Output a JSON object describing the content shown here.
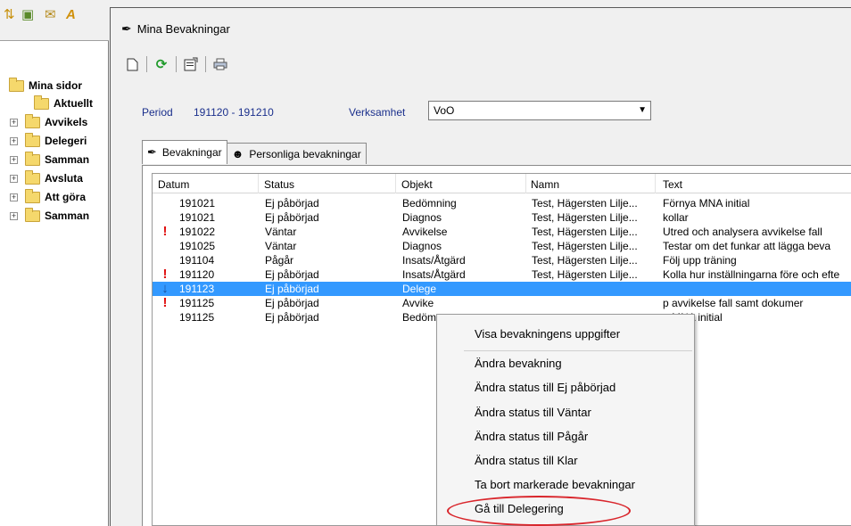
{
  "left_pane": {
    "toolbar_icons": [
      "sort-icon",
      "image-icon",
      "mail-icon",
      "font-icon"
    ],
    "tree": [
      {
        "label": "Mina sidor",
        "level": 0,
        "expandable": false
      },
      {
        "label": "Aktuellt",
        "level": 1,
        "expandable": false
      },
      {
        "label": "Avvikels",
        "level": 1,
        "expandable": true
      },
      {
        "label": "Delegeri",
        "level": 1,
        "expandable": true
      },
      {
        "label": "Samman",
        "level": 1,
        "expandable": true
      },
      {
        "label": "Avsluta",
        "level": 1,
        "expandable": true
      },
      {
        "label": "Att göra",
        "level": 1,
        "expandable": true
      },
      {
        "label": "Samman",
        "level": 1,
        "expandable": true
      }
    ]
  },
  "window": {
    "title": "Mina Bevakningar",
    "title_icon": "pen-icon"
  },
  "toolbar": {
    "icons": [
      "new-document-icon",
      "refresh-icon",
      "properties-icon",
      "print-icon"
    ]
  },
  "filter": {
    "period_label": "Period",
    "period_value": "191120 - 191210",
    "verksamhet_label": "Verksamhet",
    "verksamhet_value": "VoO"
  },
  "tabs": [
    {
      "label": "Bevakningar",
      "icon": "pen-icon",
      "active": true
    },
    {
      "label": "Personliga bevakningar",
      "icon": "person-icon",
      "active": false
    }
  ],
  "table": {
    "columns": [
      "Datum",
      "Status",
      "Objekt",
      "Namn",
      "Text"
    ],
    "rows": [
      {
        "flag": "",
        "datum": "191021",
        "status": "Ej påbörjad",
        "objekt": "Bedömning",
        "namn": "Test, Hägersten Lilje...",
        "text": "Förnya MNA initial",
        "selected": false
      },
      {
        "flag": "",
        "datum": "191021",
        "status": "Ej påbörjad",
        "objekt": "Diagnos",
        "namn": "Test, Hägersten Lilje...",
        "text": "kollar",
        "selected": false
      },
      {
        "flag": "!",
        "datum": "191022",
        "status": "Väntar",
        "objekt": "Avvikelse",
        "namn": "Test, Hägersten Lilje...",
        "text": "Utred och analysera avvikelse fall",
        "selected": false
      },
      {
        "flag": "",
        "datum": "191025",
        "status": "Väntar",
        "objekt": "Diagnos",
        "namn": "Test, Hägersten Lilje...",
        "text": "Testar om det funkar att lägga beva",
        "selected": false
      },
      {
        "flag": "",
        "datum": "191104",
        "status": "Pågår",
        "objekt": "Insats/Åtgärd",
        "namn": "Test, Hägersten Lilje...",
        "text": "Följ upp träning",
        "selected": false
      },
      {
        "flag": "!",
        "datum": "191120",
        "status": "Ej påbörjad",
        "objekt": "Insats/Åtgärd",
        "namn": "Test, Hägersten Lilje...",
        "text": "Kolla hur inställningarna före och efte",
        "selected": false
      },
      {
        "flag": "↓",
        "datum": "191123",
        "status": "Ej påbörjad",
        "objekt": "Delege",
        "namn": "",
        "text": "",
        "selected": true
      },
      {
        "flag": "!",
        "datum": "191125",
        "status": "Ej påbörjad",
        "objekt": "Avvike",
        "namn": "",
        "text": "p avvikelse fall samt dokumer",
        "selected": false
      },
      {
        "flag": "",
        "datum": "191125",
        "status": "Ej påbörjad",
        "objekt": "Bedöm",
        "namn": "",
        "text": "a MNA initial",
        "selected": false
      }
    ]
  },
  "context_menu": {
    "items": [
      "Visa bevakningens uppgifter",
      "Ändra bevakning",
      "Ändra status till Ej påbörjad",
      "Ändra status till Väntar",
      "Ändra status till Pågår",
      "Ändra status till Klar",
      "Ta bort markerade bevakningar",
      "Gå till Delegering"
    ],
    "highlight_color": "#d9262c"
  },
  "colors": {
    "selection": "#3399ff",
    "label_blue": "#1a2f8c",
    "flag_red": "#e01010"
  }
}
